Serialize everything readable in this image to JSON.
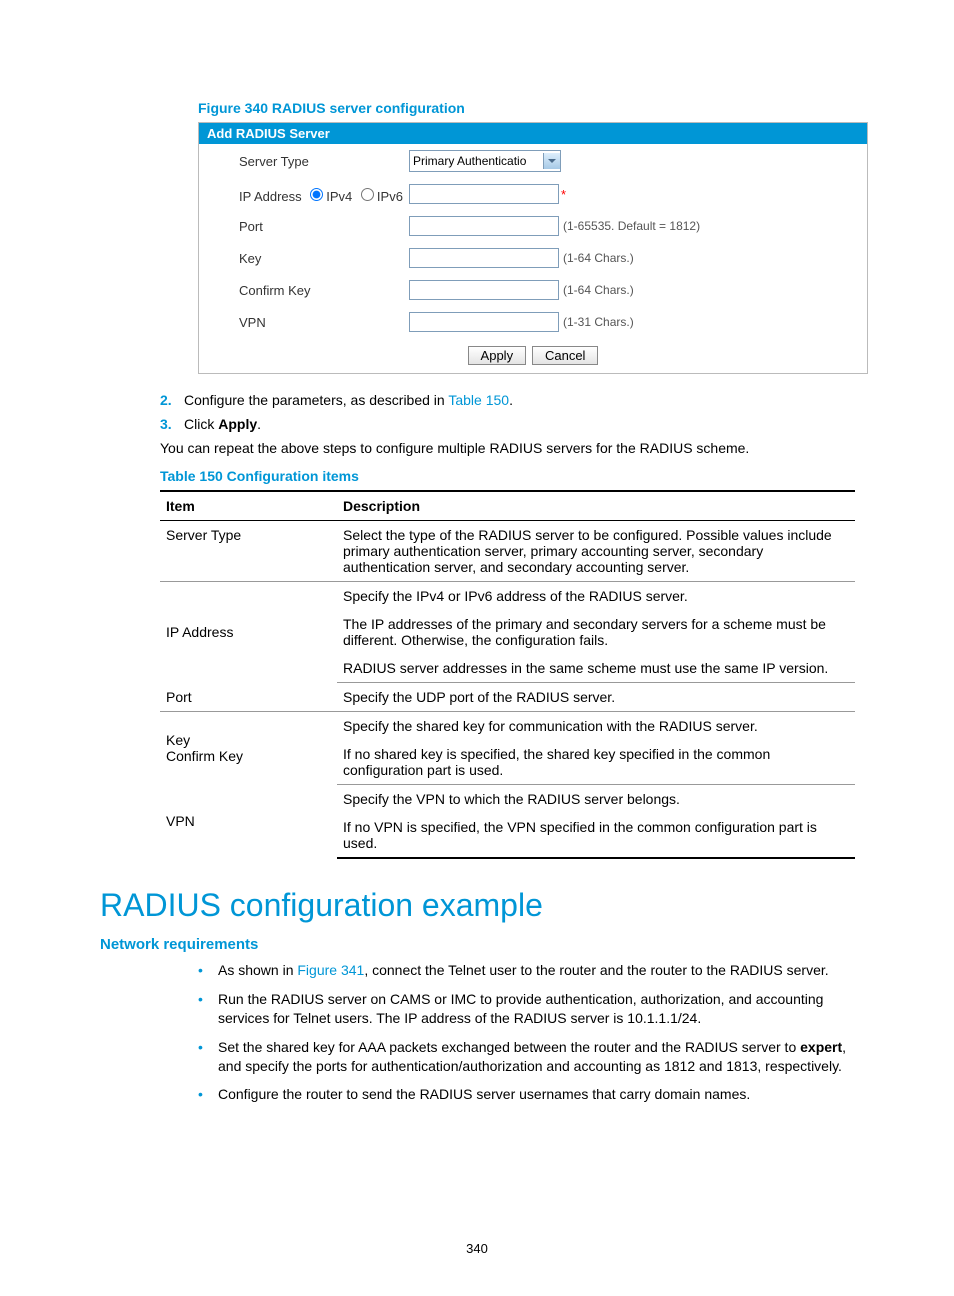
{
  "figure": {
    "caption": "Figure 340 RADIUS server configuration",
    "panel_title": "Add RADIUS Server",
    "rows": {
      "server_type_label": "Server Type",
      "server_type_value": "Primary Authenticatio",
      "ip_label": "IP Address",
      "ipv4": "IPv4",
      "ipv6": "IPv6",
      "port_label": "Port",
      "port_hint": "(1-65535. Default = 1812)",
      "key_label": "Key",
      "key_hint": "(1-64 Chars.)",
      "confirm_label": "Confirm Key",
      "confirm_hint": "(1-64 Chars.)",
      "vpn_label": "VPN",
      "vpn_hint": "(1-31 Chars.)"
    },
    "buttons": {
      "apply": "Apply",
      "cancel": "Cancel"
    }
  },
  "steps": {
    "s2_num": "2.",
    "s2_a": "Configure the parameters, as described in ",
    "s2_link": "Table 150",
    "s2_b": ".",
    "s3_num": "3.",
    "s3_a": "Click ",
    "s3_bold": "Apply",
    "s3_b": "."
  },
  "para_repeat": "You can repeat the above steps to configure multiple RADIUS servers for the RADIUS scheme.",
  "table": {
    "caption": "Table 150 Configuration items",
    "head_item": "Item",
    "head_desc": "Description",
    "r1_item": "Server Type",
    "r1_desc": "Select the type of the RADIUS server to be configured. Possible values include primary authentication server, primary accounting server, secondary authentication server, and secondary accounting server.",
    "r2_item": "IP Address",
    "r2_d1": "Specify the IPv4 or IPv6 address of the RADIUS server.",
    "r2_d2": "The IP addresses of the primary and secondary servers for a scheme must be different. Otherwise, the configuration fails.",
    "r2_d3": "RADIUS server addresses in the same scheme must use the same IP version.",
    "r3_item": "Port",
    "r3_desc": "Specify the UDP port of the RADIUS server.",
    "r4_item1": "Key",
    "r4_item2": "Confirm Key",
    "r4_d1": "Specify the shared key for communication with the RADIUS server.",
    "r4_d2": "If no shared key is specified, the shared key specified in the common configuration part is used.",
    "r5_item": "VPN",
    "r5_d1": "Specify the VPN to which the RADIUS server belongs.",
    "r5_d2": "If no VPN is specified, the VPN specified in the common configuration part is used."
  },
  "h1": "RADIUS configuration example",
  "h3": "Network requirements",
  "bullets": {
    "b1_a": "As shown in ",
    "b1_link": "Figure 341",
    "b1_b": ", connect the Telnet user to the router and the router to the RADIUS server.",
    "b2": "Run the RADIUS server on CAMS or IMC to provide authentication, authorization, and accounting services for Telnet users. The IP address of the RADIUS server is 10.1.1.1/24.",
    "b3_a": "Set the shared key for AAA packets exchanged between the router and the RADIUS server to ",
    "b3_bold": "expert",
    "b3_b": ", and specify the ports for authentication/authorization and accounting as 1812 and 1813, respectively.",
    "b4": "Configure the router to send the RADIUS server usernames that carry domain names."
  },
  "pagenum": "340"
}
